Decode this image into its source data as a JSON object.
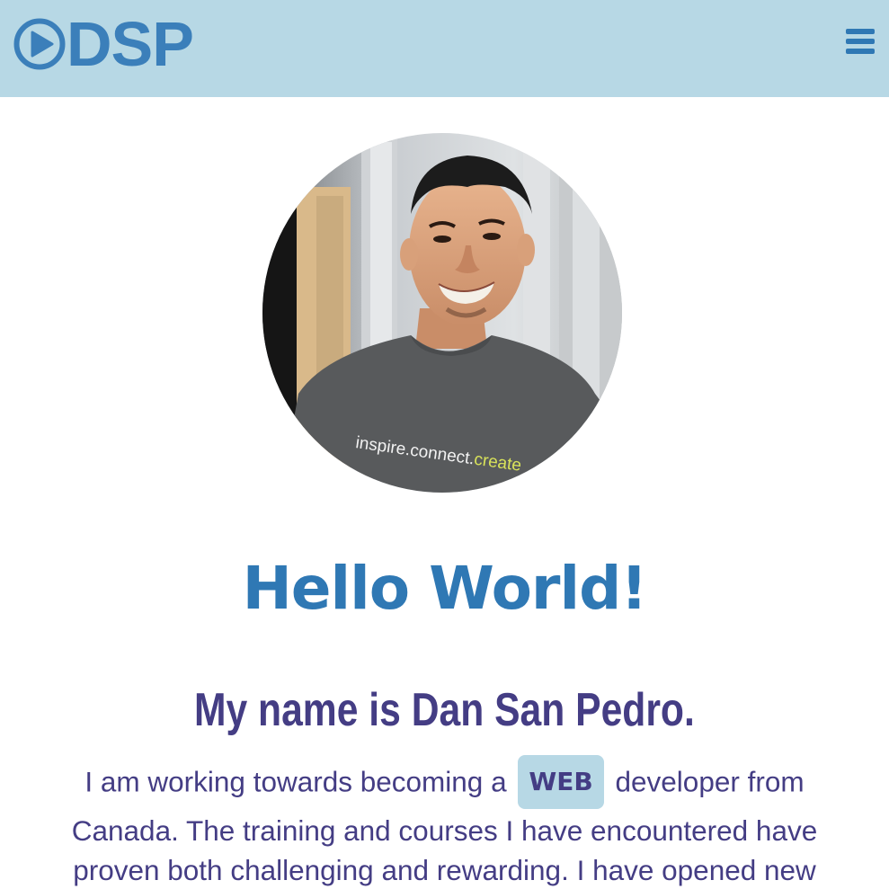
{
  "header": {
    "logo_text": "DSP",
    "logo_icon": "play-circle-icon",
    "menu_icon": "hamburger-menu-icon",
    "background_color": "#b7d8e5",
    "accent_color": "#2f78b4"
  },
  "profile": {
    "shirt_text_1": "inspire.connect.",
    "shirt_text_2": "create"
  },
  "main": {
    "greeting": "Hello World!",
    "name_heading": "My name is Dan San Pedro.",
    "bio_before": "I am working towards becoming a",
    "bio_badge": "WEB",
    "bio_after": "developer from Canada. The training and courses I have encountered have proven both challenging and rewarding. I have opened new",
    "text_color": "#443d84"
  }
}
